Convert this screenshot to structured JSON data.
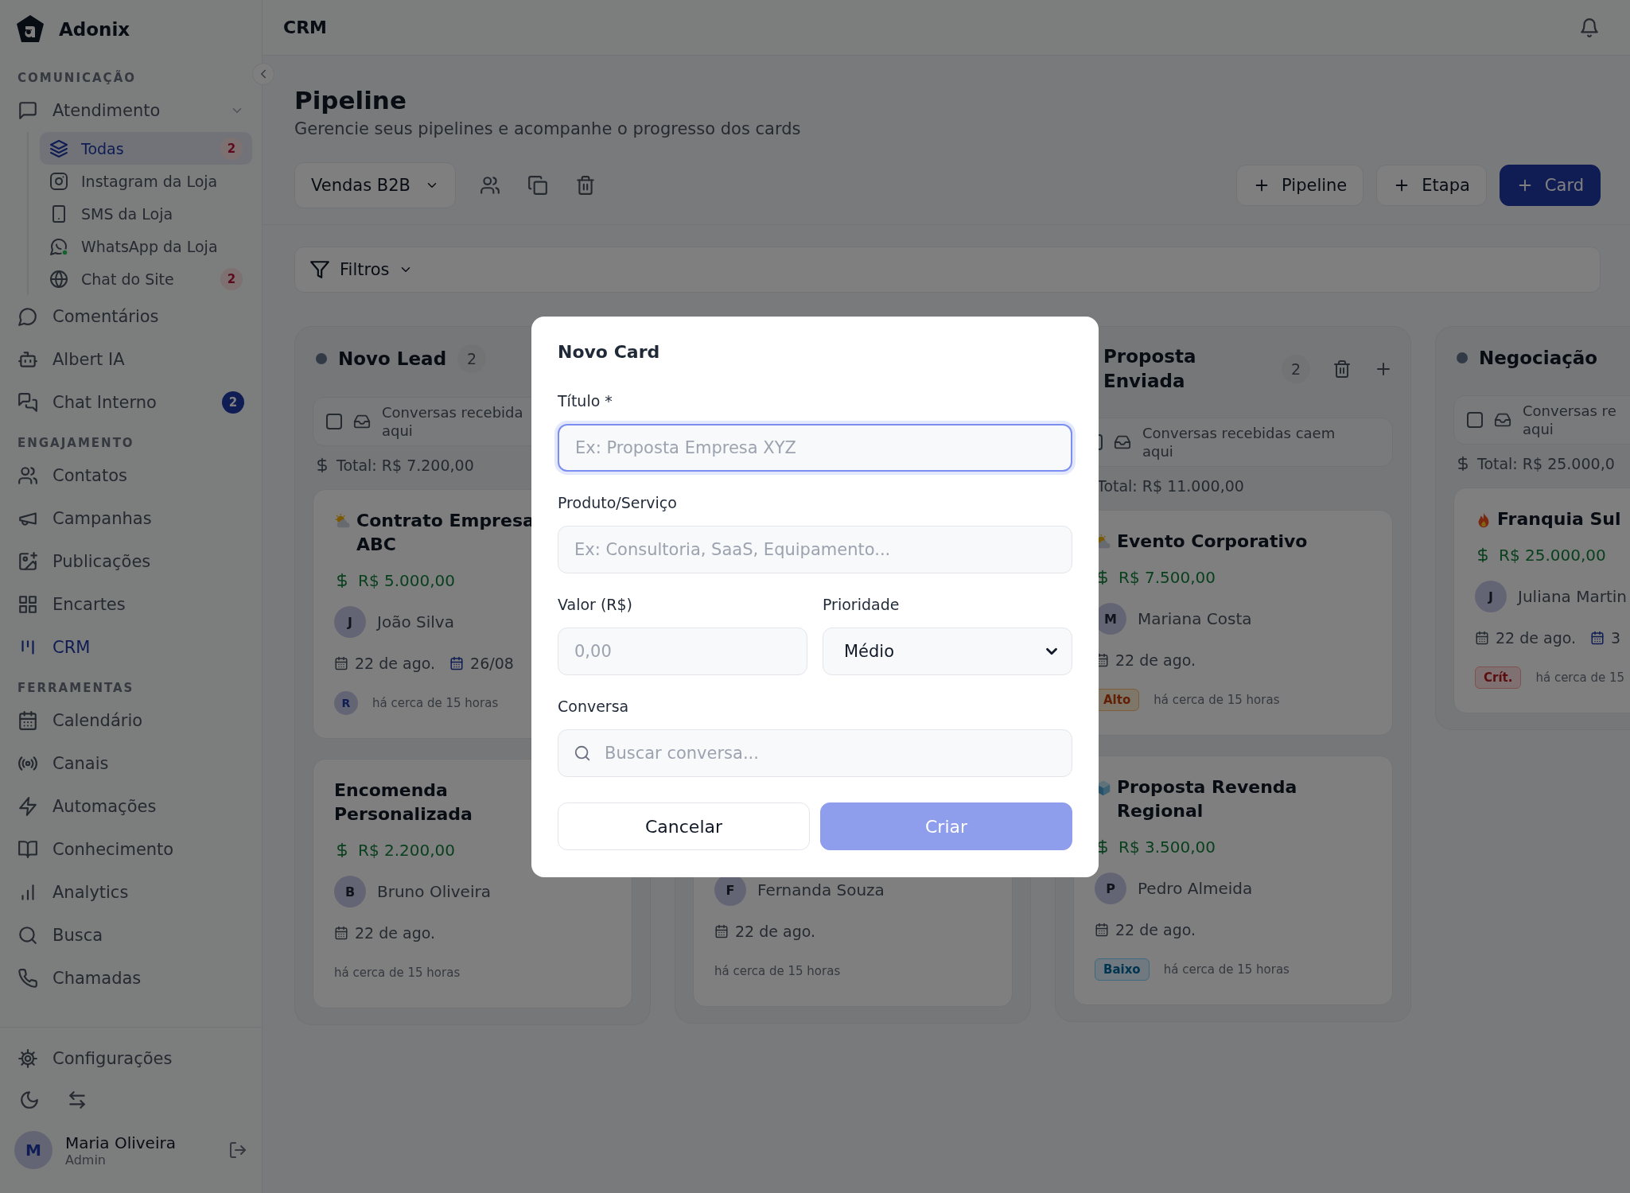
{
  "app": {
    "name": "Adonix"
  },
  "sidebar": {
    "sections": [
      {
        "heading": "COMUNICAÇÃO",
        "items": [
          {
            "label": "Atendimento",
            "selected": false,
            "expanded": true,
            "children": [
              {
                "label": "Todas",
                "selected": true,
                "badge": {
                  "text": "2",
                  "kind": "alert"
                }
              },
              {
                "label": "Instagram da Loja",
                "selected": false
              },
              {
                "label": "SMS da Loja",
                "selected": false
              },
              {
                "label": "WhatsApp da Loja",
                "selected": false
              },
              {
                "label": "Chat do Site",
                "selected": false,
                "badge": {
                  "text": "2",
                  "kind": "alert"
                }
              }
            ]
          },
          {
            "label": "Comentários",
            "selected": false
          },
          {
            "label": "Albert IA",
            "selected": false
          },
          {
            "label": "Chat Interno",
            "selected": false,
            "badge": {
              "text": "2",
              "kind": "count"
            }
          }
        ]
      },
      {
        "heading": "ENGAJAMENTO",
        "items": [
          {
            "label": "Contatos",
            "selected": false
          },
          {
            "label": "Campanhas",
            "selected": false
          },
          {
            "label": "Publicações",
            "selected": false
          },
          {
            "label": "Encartes",
            "selected": false
          },
          {
            "label": "CRM",
            "selected": true
          }
        ]
      },
      {
        "heading": "FERRAMENTAS",
        "items": [
          {
            "label": "Calendário",
            "selected": false
          },
          {
            "label": "Canais",
            "selected": false
          },
          {
            "label": "Automações",
            "selected": false
          },
          {
            "label": "Conhecimento",
            "selected": false
          },
          {
            "label": "Analytics",
            "selected": false
          },
          {
            "label": "Busca",
            "selected": false
          },
          {
            "label": "Chamadas",
            "selected": false
          }
        ]
      }
    ],
    "settings": {
      "label": "Configurações"
    },
    "user": {
      "initial": "M",
      "name": "Maria Oliveira",
      "role": "Admin"
    }
  },
  "header": {
    "title": "CRM"
  },
  "page": {
    "title": "Pipeline",
    "subtitle": "Gerencie seus pipelines e acompanhe o progresso dos cards",
    "pipeline_select": "Vendas B2B",
    "buttons": [
      {
        "label": "Pipeline",
        "kind": "secondary"
      },
      {
        "label": "Etapa",
        "kind": "secondary"
      },
      {
        "label": "Card",
        "kind": "primary"
      }
    ],
    "filter": "Filtros"
  },
  "columns": [
    {
      "title": "Novo Lead",
      "count": "2",
      "show_actions": false,
      "inbox_checked": false,
      "inbox_lines": [
        "Conversas recebida",
        "aqui"
      ],
      "total": "Total: R$ 7.200,00",
      "cards": [
        {
          "title": "Contrato Empresa ABC",
          "value": "R$ 5.000,00",
          "assignee_initial": "J",
          "assignee": "João Silva",
          "date": "22 de ago.",
          "due": "26/08",
          "creator_initial": "R",
          "age": "há cerca de 15 horas"
        },
        {
          "title": "Encomenda Personalizada",
          "value": "R$ 2.200,00",
          "assignee_initial": "B",
          "assignee": "Bruno Oliveira",
          "date": "22 de ago.",
          "age": "há cerca de 15 horas"
        }
      ]
    },
    {
      "cards": [
        {
          "assignee_initial": "F",
          "assignee": "Fernanda Souza",
          "date": "22 de ago.",
          "age": "há cerca de 15 horas"
        }
      ]
    },
    {
      "title": "Proposta Enviada",
      "count": "2",
      "show_actions": true,
      "inbox_checked": false,
      "inbox_lines": [
        "Conversas recebidas caem",
        "aqui"
      ],
      "total": "Total: R$ 11.000,00",
      "cards": [
        {
          "title": "Evento Corporativo",
          "value": "R$ 7.500,00",
          "assignee_initial": "M",
          "assignee": "Mariana Costa",
          "date": "22 de ago.",
          "priority": {
            "label": "Alto",
            "kind": "high"
          },
          "age": "há cerca de 15 horas"
        },
        {
          "title": "Proposta Revenda Regional",
          "value": "R$ 3.500,00",
          "assignee_initial": "P",
          "assignee": "Pedro Almeida",
          "date": "22 de ago.",
          "priority": {
            "label": "Baixo",
            "kind": "low"
          },
          "age": "há cerca de 15 horas"
        }
      ]
    },
    {
      "title": "Negociação",
      "show_actions": false,
      "inbox_checked": false,
      "inbox_lines": [
        "Conversas re",
        "aqui"
      ],
      "total": "Total: R$ 25.000,0",
      "cards": [
        {
          "title": "Franquia Sul",
          "value": "R$ 25.000,00",
          "assignee_initial": "J",
          "assignee": "Juliana Martin",
          "date": "22 de ago.",
          "due": "3",
          "priority": {
            "label": "Crít.",
            "kind": "critical"
          },
          "age": "há cerca de 15"
        }
      ]
    }
  ],
  "modal": {
    "title": "Novo Card",
    "title_field": {
      "label": "Título *",
      "placeholder": "Ex: Proposta Empresa XYZ",
      "focused": true
    },
    "product_field": {
      "label": "Produto/Serviço",
      "placeholder": "Ex: Consultoria, SaaS, Equipamento..."
    },
    "value_field": {
      "label": "Valor (R$)",
      "placeholder": "0,00"
    },
    "priority_field": {
      "label": "Prioridade",
      "value": "Médio"
    },
    "conversation_field": {
      "label": "Conversa",
      "placeholder": "Buscar conversa..."
    },
    "cancel": {
      "label": "Cancelar"
    },
    "create": {
      "label": "Criar",
      "disabled": true
    }
  }
}
